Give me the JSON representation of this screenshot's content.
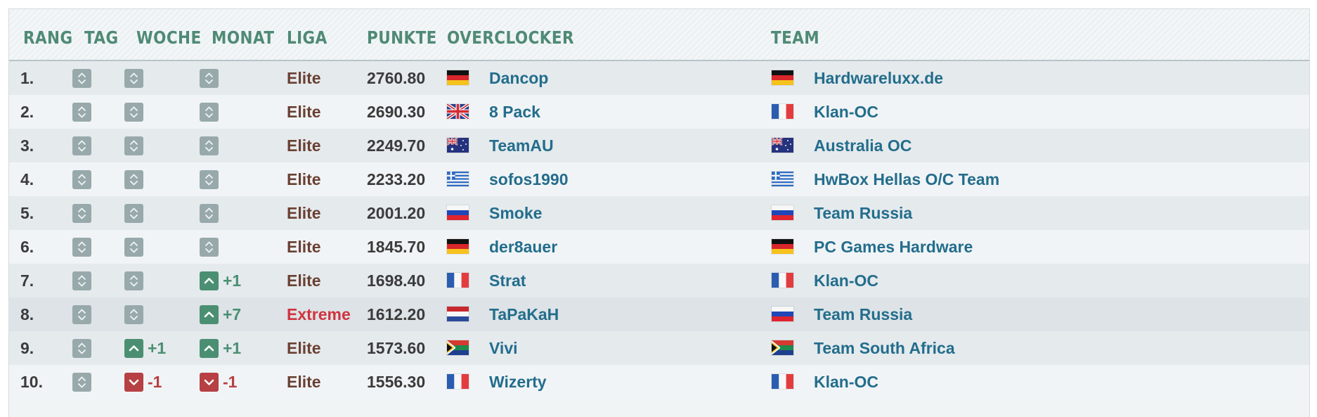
{
  "headers": {
    "rang": "RANG",
    "tag": "TAG",
    "woche": "WOCHE",
    "monat": "MONAT",
    "liga": "LIGA",
    "punkte": "PUNKTE",
    "overclocker": "OVERCLOCKER",
    "team": "TEAM"
  },
  "rows": [
    {
      "rank": "1.",
      "tag": {
        "dir": "same",
        "delta": ""
      },
      "woche": {
        "dir": "same",
        "delta": ""
      },
      "monat": {
        "dir": "same",
        "delta": ""
      },
      "liga": "Elite",
      "punkte": "2760.80",
      "oc_flag": "de",
      "overclocker": "Dancop",
      "team_flag": "de",
      "team": "Hardwareluxx.de"
    },
    {
      "rank": "2.",
      "tag": {
        "dir": "same",
        "delta": ""
      },
      "woche": {
        "dir": "same",
        "delta": ""
      },
      "monat": {
        "dir": "same",
        "delta": ""
      },
      "liga": "Elite",
      "punkte": "2690.30",
      "oc_flag": "gb",
      "overclocker": "8 Pack",
      "team_flag": "fr",
      "team": "Klan-OC"
    },
    {
      "rank": "3.",
      "tag": {
        "dir": "same",
        "delta": ""
      },
      "woche": {
        "dir": "same",
        "delta": ""
      },
      "monat": {
        "dir": "same",
        "delta": ""
      },
      "liga": "Elite",
      "punkte": "2249.70",
      "oc_flag": "au",
      "overclocker": "TeamAU",
      "team_flag": "au",
      "team": "Australia OC"
    },
    {
      "rank": "4.",
      "tag": {
        "dir": "same",
        "delta": ""
      },
      "woche": {
        "dir": "same",
        "delta": ""
      },
      "monat": {
        "dir": "same",
        "delta": ""
      },
      "liga": "Elite",
      "punkte": "2233.20",
      "oc_flag": "gr",
      "overclocker": "sofos1990",
      "team_flag": "gr",
      "team": "HwBox Hellas O/C Team"
    },
    {
      "rank": "5.",
      "tag": {
        "dir": "same",
        "delta": ""
      },
      "woche": {
        "dir": "same",
        "delta": ""
      },
      "monat": {
        "dir": "same",
        "delta": ""
      },
      "liga": "Elite",
      "punkte": "2001.20",
      "oc_flag": "ru",
      "overclocker": "Smoke",
      "team_flag": "ru",
      "team": "Team Russia"
    },
    {
      "rank": "6.",
      "tag": {
        "dir": "same",
        "delta": ""
      },
      "woche": {
        "dir": "same",
        "delta": ""
      },
      "monat": {
        "dir": "same",
        "delta": ""
      },
      "liga": "Elite",
      "punkte": "1845.70",
      "oc_flag": "de",
      "overclocker": "der8auer",
      "team_flag": "de",
      "team": "PC Games Hardware"
    },
    {
      "rank": "7.",
      "tag": {
        "dir": "same",
        "delta": ""
      },
      "woche": {
        "dir": "same",
        "delta": ""
      },
      "monat": {
        "dir": "up",
        "delta": "+1"
      },
      "liga": "Elite",
      "punkte": "1698.40",
      "oc_flag": "fr",
      "overclocker": "Strat",
      "team_flag": "fr",
      "team": "Klan-OC"
    },
    {
      "rank": "8.",
      "tag": {
        "dir": "same",
        "delta": ""
      },
      "woche": {
        "dir": "same",
        "delta": ""
      },
      "monat": {
        "dir": "up",
        "delta": "+7"
      },
      "liga": "Extreme",
      "punkte": "1612.20",
      "oc_flag": "nl",
      "overclocker": "TaPaKaH",
      "team_flag": "ru",
      "team": "Team Russia"
    },
    {
      "rank": "9.",
      "tag": {
        "dir": "same",
        "delta": ""
      },
      "woche": {
        "dir": "up",
        "delta": "+1"
      },
      "monat": {
        "dir": "up",
        "delta": "+1"
      },
      "liga": "Elite",
      "punkte": "1573.60",
      "oc_flag": "za",
      "overclocker": "Vivi",
      "team_flag": "za",
      "team": "Team South Africa"
    },
    {
      "rank": "10.",
      "tag": {
        "dir": "same",
        "delta": ""
      },
      "woche": {
        "dir": "down",
        "delta": "-1"
      },
      "monat": {
        "dir": "down",
        "delta": "-1"
      },
      "liga": "Elite",
      "punkte": "1556.30",
      "oc_flag": "fr",
      "overclocker": "Wizerty",
      "team_flag": "fr",
      "team": "Klan-OC"
    }
  ],
  "colors": {
    "header_text": "#4f8a75",
    "link": "#236d8c",
    "liga_elite": "#6a4033",
    "liga_extreme": "#d0333f",
    "trend_same": "#98a9ac",
    "trend_up": "#4b8f72",
    "trend_down": "#b64043"
  }
}
